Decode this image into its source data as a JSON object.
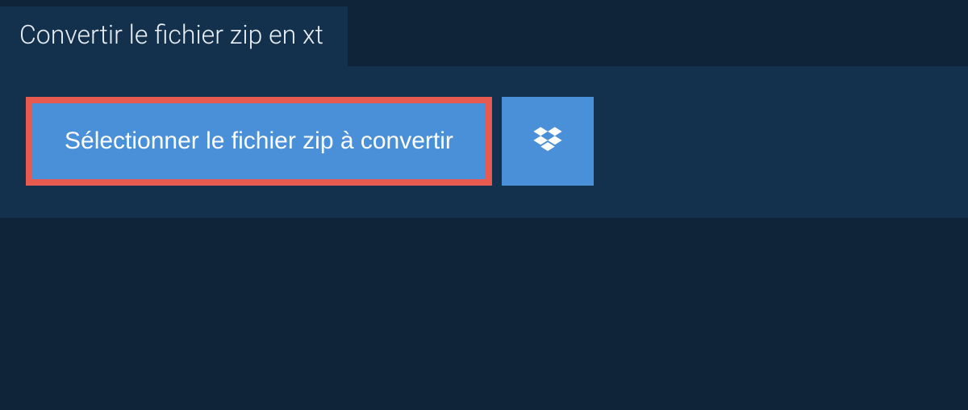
{
  "header": {
    "title": "Convertir le fichier zip en xt"
  },
  "actions": {
    "select_file_label": "Sélectionner le fichier zip à convertir",
    "dropbox_icon": "dropbox-icon"
  },
  "colors": {
    "background": "#0f2438",
    "panel": "#13314d",
    "button": "#4a90d9",
    "highlight_border": "#e65a4f"
  }
}
